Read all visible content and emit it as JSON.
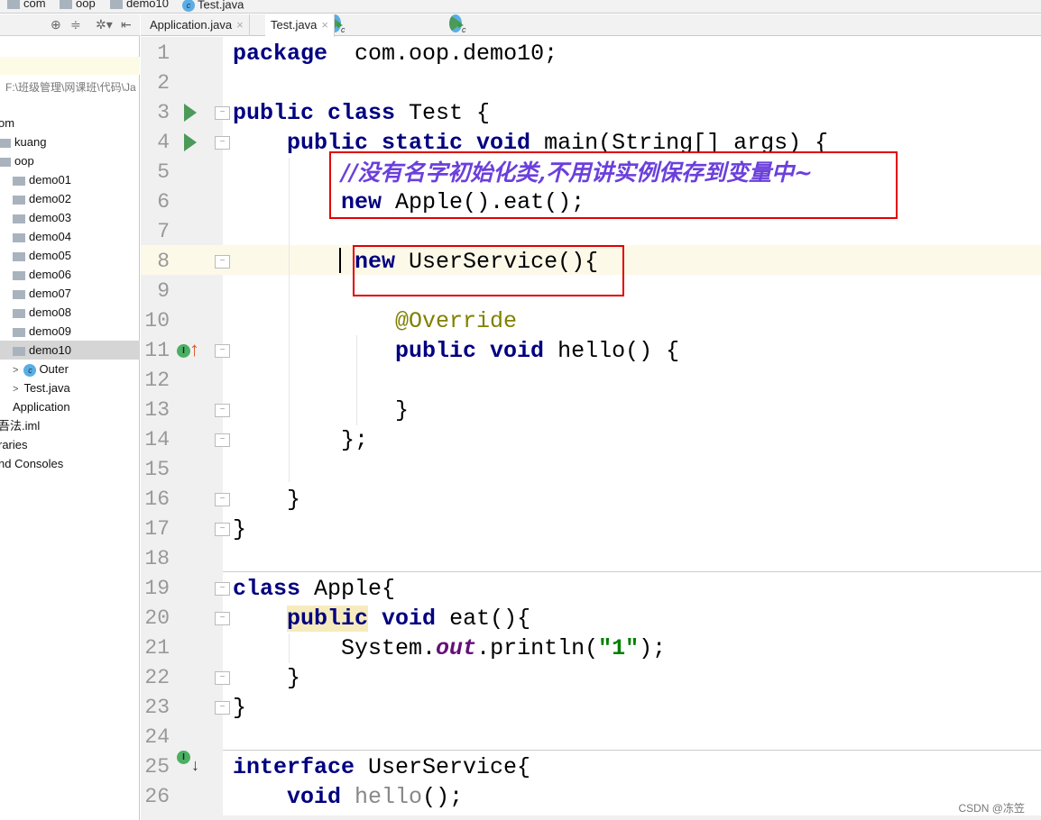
{
  "breadcrumb": [
    "com",
    "oop",
    "demo10",
    "Test.java"
  ],
  "sidebar": {
    "toolbar_icons": [
      "locate-icon",
      "collapse-icon",
      "gear-icon",
      "hide-icon"
    ],
    "project_path": "F:\\班级管理\\网课班\\代码\\Ja",
    "items": [
      {
        "label": "om",
        "indent": 0,
        "type": "text"
      },
      {
        "label": "kuang",
        "indent": 1,
        "type": "folder"
      },
      {
        "label": "oop",
        "indent": 1,
        "type": "folder"
      },
      {
        "label": "demo01",
        "indent": 2,
        "type": "folder"
      },
      {
        "label": "demo02",
        "indent": 2,
        "type": "folder"
      },
      {
        "label": "demo03",
        "indent": 2,
        "type": "folder"
      },
      {
        "label": "demo04",
        "indent": 2,
        "type": "folder"
      },
      {
        "label": "demo05",
        "indent": 2,
        "type": "folder"
      },
      {
        "label": "demo06",
        "indent": 2,
        "type": "folder"
      },
      {
        "label": "demo07",
        "indent": 2,
        "type": "folder"
      },
      {
        "label": "demo08",
        "indent": 2,
        "type": "folder"
      },
      {
        "label": "demo09",
        "indent": 2,
        "type": "folder"
      },
      {
        "label": "demo10",
        "indent": 2,
        "type": "folder",
        "selected": true
      },
      {
        "label": "Outer",
        "indent": 3,
        "type": "class",
        "expand": true
      },
      {
        "label": "Test.java",
        "indent": 3,
        "type": "runclass",
        "expand": true
      },
      {
        "label": "Application",
        "indent": 2,
        "type": "runclass"
      },
      {
        "label": "吾法.iml",
        "indent": 0,
        "type": "text"
      },
      {
        "label": "raries",
        "indent": 0,
        "type": "text"
      },
      {
        "label": "nd Consoles",
        "indent": 0,
        "type": "text"
      }
    ]
  },
  "tabs": [
    {
      "label": "Application.java",
      "active": false
    },
    {
      "label": "Test.java",
      "active": true
    }
  ],
  "editor": {
    "current_line": 8,
    "lines": [
      [
        [
          "kw",
          "package"
        ],
        [
          "",
          "  com.oop.demo10;"
        ]
      ],
      [],
      [
        [
          "kw",
          "public class"
        ],
        [
          "",
          " Test {"
        ]
      ],
      [
        [
          "",
          "    "
        ],
        [
          "kw",
          "public static void"
        ],
        [
          "",
          " main(String[] args) {"
        ]
      ],
      [
        [
          "",
          "        "
        ],
        [
          "cm",
          "//没有名字初始化类,不用讲实例保存到变量中~"
        ]
      ],
      [
        [
          "",
          "        "
        ],
        [
          "kw",
          "new"
        ],
        [
          "",
          " Apple().eat();"
        ]
      ],
      [],
      [
        [
          "",
          "         "
        ],
        [
          "kw",
          "new"
        ],
        [
          "",
          " UserService(){"
        ]
      ],
      [],
      [
        [
          "",
          "            "
        ],
        [
          "an",
          "@Override"
        ]
      ],
      [
        [
          "",
          "            "
        ],
        [
          "kw",
          "public void"
        ],
        [
          "",
          " hello() {"
        ]
      ],
      [],
      [
        [
          "",
          "            }"
        ]
      ],
      [
        [
          "",
          "        };"
        ]
      ],
      [],
      [
        [
          "",
          "    }"
        ]
      ],
      [
        [
          "",
          "}"
        ]
      ],
      [],
      [
        [
          "kw",
          "class"
        ],
        [
          "",
          " Apple{"
        ]
      ],
      [
        [
          "",
          "    "
        ],
        [
          "kwh",
          "public"
        ],
        [
          "",
          " "
        ],
        [
          "kw",
          "void"
        ],
        [
          "",
          " eat(){"
        ]
      ],
      [
        [
          "",
          "        System."
        ],
        [
          "fd",
          "out"
        ],
        [
          "",
          ".println("
        ],
        [
          "st",
          "\"1\""
        ],
        [
          "",
          ");"
        ]
      ],
      [
        [
          "",
          "    }"
        ]
      ],
      [
        [
          "",
          "}"
        ]
      ],
      [],
      [
        [
          "kw",
          "interface"
        ],
        [
          "",
          " UserService{"
        ]
      ],
      [
        [
          "",
          "    "
        ],
        [
          "kw",
          "void"
        ],
        [
          "",
          " "
        ],
        [
          "un",
          "hello"
        ],
        [
          "",
          "();"
        ]
      ]
    ],
    "run_lines": [
      3,
      4
    ],
    "implements_lines": [
      11
    ],
    "implemented_lines": [
      25
    ],
    "fold_lines": [
      3,
      4,
      8,
      11,
      13,
      14,
      16,
      17,
      19,
      20,
      22,
      23
    ]
  },
  "watermark": "CSDN @冻笠",
  "colors": {
    "annotation_box": "#e00000",
    "keyword": "#000080",
    "comment": "#6b3fdc"
  }
}
